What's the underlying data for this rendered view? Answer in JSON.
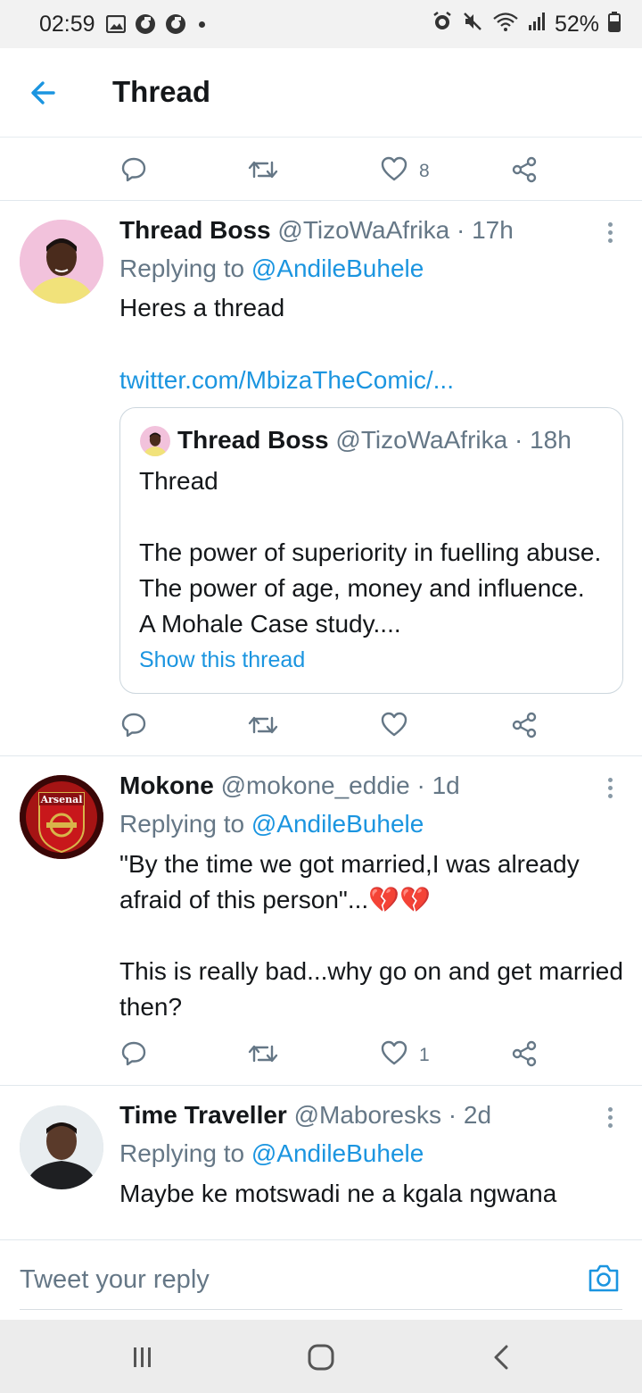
{
  "status_bar": {
    "time": "02:59",
    "battery": "52%",
    "left_icons": [
      "image-icon",
      "app-icon",
      "app-icon",
      "dot-icon"
    ],
    "right_icons": [
      "alarm-icon",
      "mute-icon",
      "wifi-icon",
      "signal-icon",
      "battery-icon"
    ]
  },
  "header": {
    "title": "Thread",
    "back_icon": "arrow-left-icon"
  },
  "top_actions": {
    "like_count": "8"
  },
  "tweets": [
    {
      "name": "Thread Boss",
      "handle": "@TizoWaAfrika",
      "time": " · 17h",
      "replying_prefix": "Replying to ",
      "replying_to": "@AndileBuhele",
      "text_line1": "Heres a thread",
      "link": "twitter.com/MbizaTheComic/...",
      "quote": {
        "name": "Thread Boss",
        "handle": "@TizoWaAfrika",
        "time": " · 18h",
        "text_line1": "Thread",
        "text_body": "The power of superiority in fuelling abuse. The power of age, money and influence. A Mohale Case study....",
        "show_thread": "Show this thread"
      },
      "like_count": ""
    },
    {
      "name": "Mokone",
      "handle": "@mokone_eddie",
      "time": " · 1d",
      "replying_prefix": "Replying to ",
      "replying_to": "@AndileBuhele",
      "text_para1": "\"By the time we got married,I was already afraid of this person\"...",
      "emoji": "💔💔",
      "text_para2": "This is really bad...why go on and get married then?",
      "like_count": "1",
      "avatar_label": "Arsenal"
    },
    {
      "name": "Time Traveller",
      "handle": "@Maboresks",
      "time": " · 2d",
      "replying_prefix": "Replying to ",
      "replying_to": "@AndileBuhele",
      "text_line1": "Maybe ke motswadi ne a kgala ngwana"
    }
  ],
  "reply_bar": {
    "placeholder": "Tweet your reply",
    "camera_icon": "camera-icon"
  },
  "nav_bar": {
    "icons": [
      "recent-apps-icon",
      "home-icon",
      "back-icon"
    ]
  },
  "colors": {
    "accent": "#1b95e0",
    "secondary_text": "#657786",
    "status_bar_bg": "#f2f2f2",
    "nav_bar_bg": "#ececec"
  }
}
